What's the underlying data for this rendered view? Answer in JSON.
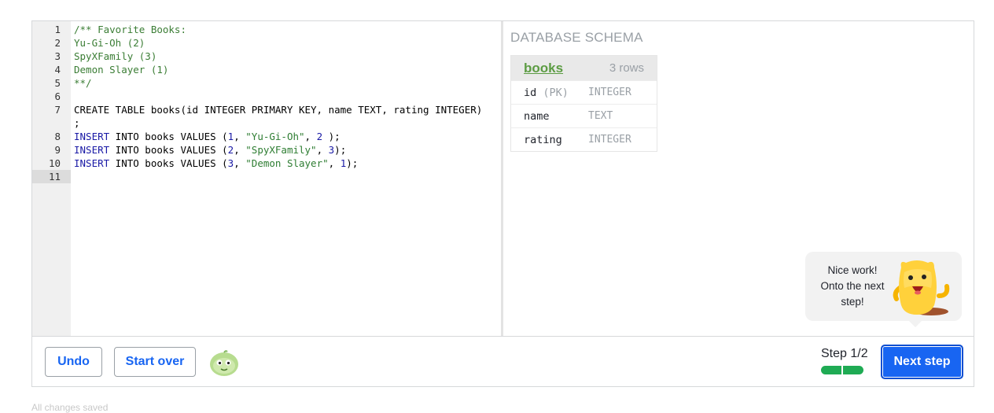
{
  "editor": {
    "lines": [
      {
        "num": "1",
        "parts": [
          {
            "t": "/** Favorite Books:",
            "c": "cmt"
          }
        ]
      },
      {
        "num": "2",
        "parts": [
          {
            "t": "Yu-Gi-Oh (2)",
            "c": "cmt"
          }
        ]
      },
      {
        "num": "3",
        "parts": [
          {
            "t": "SpyXFamily (3)",
            "c": "cmt"
          }
        ]
      },
      {
        "num": "4",
        "parts": [
          {
            "t": "Demon Slayer (1)",
            "c": "cmt"
          }
        ]
      },
      {
        "num": "5",
        "parts": [
          {
            "t": "**/",
            "c": "cmt"
          }
        ]
      },
      {
        "num": "6",
        "parts": []
      },
      {
        "num": "7",
        "parts": [
          {
            "t": "CREATE TABLE books(id INTEGER PRIMARY KEY, name TEXT, rating INTEGER)",
            "c": ""
          }
        ]
      },
      {
        "num": "",
        "parts": [
          {
            "t": ";",
            "c": ""
          }
        ]
      },
      {
        "num": "8",
        "parts": [
          {
            "t": "INSERT",
            "c": "kw"
          },
          {
            "t": " INTO books VALUES (",
            "c": ""
          },
          {
            "t": "1",
            "c": "num"
          },
          {
            "t": ", ",
            "c": ""
          },
          {
            "t": "\"Yu-Gi-Oh\"",
            "c": "str"
          },
          {
            "t": ", ",
            "c": ""
          },
          {
            "t": "2",
            "c": "num"
          },
          {
            "t": " );",
            "c": ""
          }
        ]
      },
      {
        "num": "9",
        "parts": [
          {
            "t": "INSERT",
            "c": "kw"
          },
          {
            "t": " INTO books VALUES (",
            "c": ""
          },
          {
            "t": "2",
            "c": "num"
          },
          {
            "t": ", ",
            "c": ""
          },
          {
            "t": "\"SpyXFamily\"",
            "c": "str"
          },
          {
            "t": ", ",
            "c": ""
          },
          {
            "t": "3",
            "c": "num"
          },
          {
            "t": ");",
            "c": ""
          }
        ]
      },
      {
        "num": "10",
        "parts": [
          {
            "t": "INSERT",
            "c": "kw"
          },
          {
            "t": " INTO books VALUES (",
            "c": ""
          },
          {
            "t": "3",
            "c": "num"
          },
          {
            "t": ", ",
            "c": ""
          },
          {
            "t": "\"Demon Slayer\"",
            "c": "str"
          },
          {
            "t": ", ",
            "c": ""
          },
          {
            "t": "1",
            "c": "num"
          },
          {
            "t": ");",
            "c": ""
          }
        ]
      },
      {
        "num": "11",
        "parts": [],
        "active": true
      }
    ]
  },
  "schema": {
    "title": "DATABASE SCHEMA",
    "table": {
      "name": "books",
      "rows_label": "3 rows",
      "columns": [
        {
          "name": "id",
          "pk": "(PK)",
          "type": "INTEGER"
        },
        {
          "name": "name",
          "pk": "",
          "type": "TEXT"
        },
        {
          "name": "rating",
          "pk": "",
          "type": "INTEGER"
        }
      ]
    }
  },
  "bubble": {
    "line1": "Nice work!",
    "line2": "Onto the next",
    "line3": "step!"
  },
  "bottom": {
    "undo_label": "Undo",
    "start_over_label": "Start over",
    "step_label": "Step 1/2",
    "progress_completed": 2,
    "progress_total": 2,
    "next_label": "Next step"
  },
  "colors": {
    "accent": "#1865f2",
    "progress": "#1fab54",
    "table_name": "#5c9c43"
  },
  "footer": {
    "text": "All changes saved"
  }
}
